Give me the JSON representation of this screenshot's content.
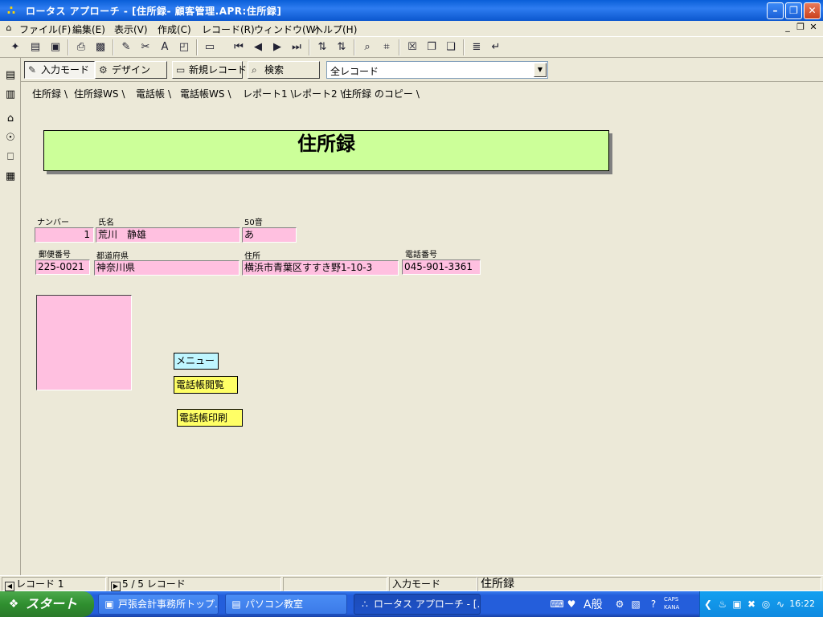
{
  "window": {
    "app_icon": "lotus-approach-icon",
    "title": "ロータス アプローチ - [住所録- 顧客管理.APR:住所録]"
  },
  "menu": {
    "items": [
      "ファイル(F)",
      "編集(E)",
      "表示(V)",
      "作成(C)",
      "レコード(R)",
      "ウィンドウ(W)",
      "ヘルプ(H)"
    ]
  },
  "modebar": {
    "input_mode": "入力モード",
    "design": "デザイン",
    "new_record": "新規レコード",
    "search": "検索",
    "record_filter": "全レコード"
  },
  "tabs": [
    "住所録",
    "住所録WS",
    "電話帳",
    "電話帳WS",
    "レポート1",
    "レポート2",
    "住所録 のコピー"
  ],
  "form": {
    "title": "住所録",
    "labels": {
      "number": "ナンバー",
      "name": "氏名",
      "kana": "50音",
      "postal": "郵便番号",
      "prefecture": "都道府県",
      "address": "住所",
      "phone": "電話番号"
    },
    "values": {
      "number": "1",
      "name": "荒川　静雄",
      "kana": "あ",
      "postal": "225-0021",
      "prefecture": "神奈川県",
      "address": "横浜市青葉区すすき野1-10-3",
      "phone": "045-901-3361"
    },
    "menu_label": "メニュー",
    "button_view": "電話帳閲覧",
    "button_print": "電話帳印刷"
  },
  "status": {
    "record": "レコード 1",
    "count": "5 / 5 レコード",
    "mode": "入力モード",
    "view": "住所録"
  },
  "taskbar": {
    "start": "スタート",
    "tasks": [
      "戸張会計事務所トップ...",
      "パソコン教室",
      "ロータス アプローチ - [..."
    ],
    "ime_mode": "A般",
    "caps": "CAPS",
    "kana": "KANA",
    "clock": "16:22"
  }
}
